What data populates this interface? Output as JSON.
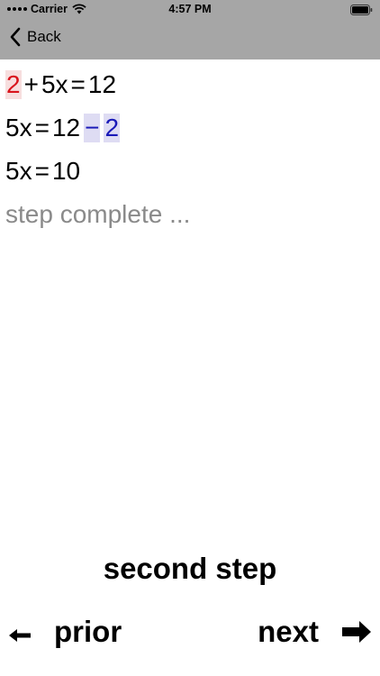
{
  "status_bar": {
    "carrier": "Carrier",
    "time": "4:57 PM",
    "icons": [
      "signal-dots-icon",
      "wifi-icon",
      "battery-icon"
    ]
  },
  "nav": {
    "back_label": "Back",
    "back_icon": "chevron-left-icon"
  },
  "equations": {
    "line1": {
      "t1": "2",
      "op1": "+",
      "t2": "5x",
      "op2": "=",
      "t3": "12"
    },
    "line2": {
      "t1": "5x",
      "op1": "=",
      "t2": "12",
      "op2": "−",
      "t3": "2"
    },
    "line3": {
      "t1": "5x",
      "op1": "=",
      "t2": "10"
    }
  },
  "status_text": "step complete ...",
  "step_title": "second step",
  "controls": {
    "prior_label": "prior",
    "next_label": "next",
    "prior_icon": "arrow-left-icon",
    "next_icon": "arrow-right-icon"
  },
  "colors": {
    "nav_background": "#a6a6a6",
    "highlight_red": "#d9141c",
    "highlight_red_bg": "#f7dede",
    "highlight_blue": "#1a1ab8",
    "highlight_blue_bg": "#dedcf3",
    "status_text": "#8a8a8a"
  }
}
